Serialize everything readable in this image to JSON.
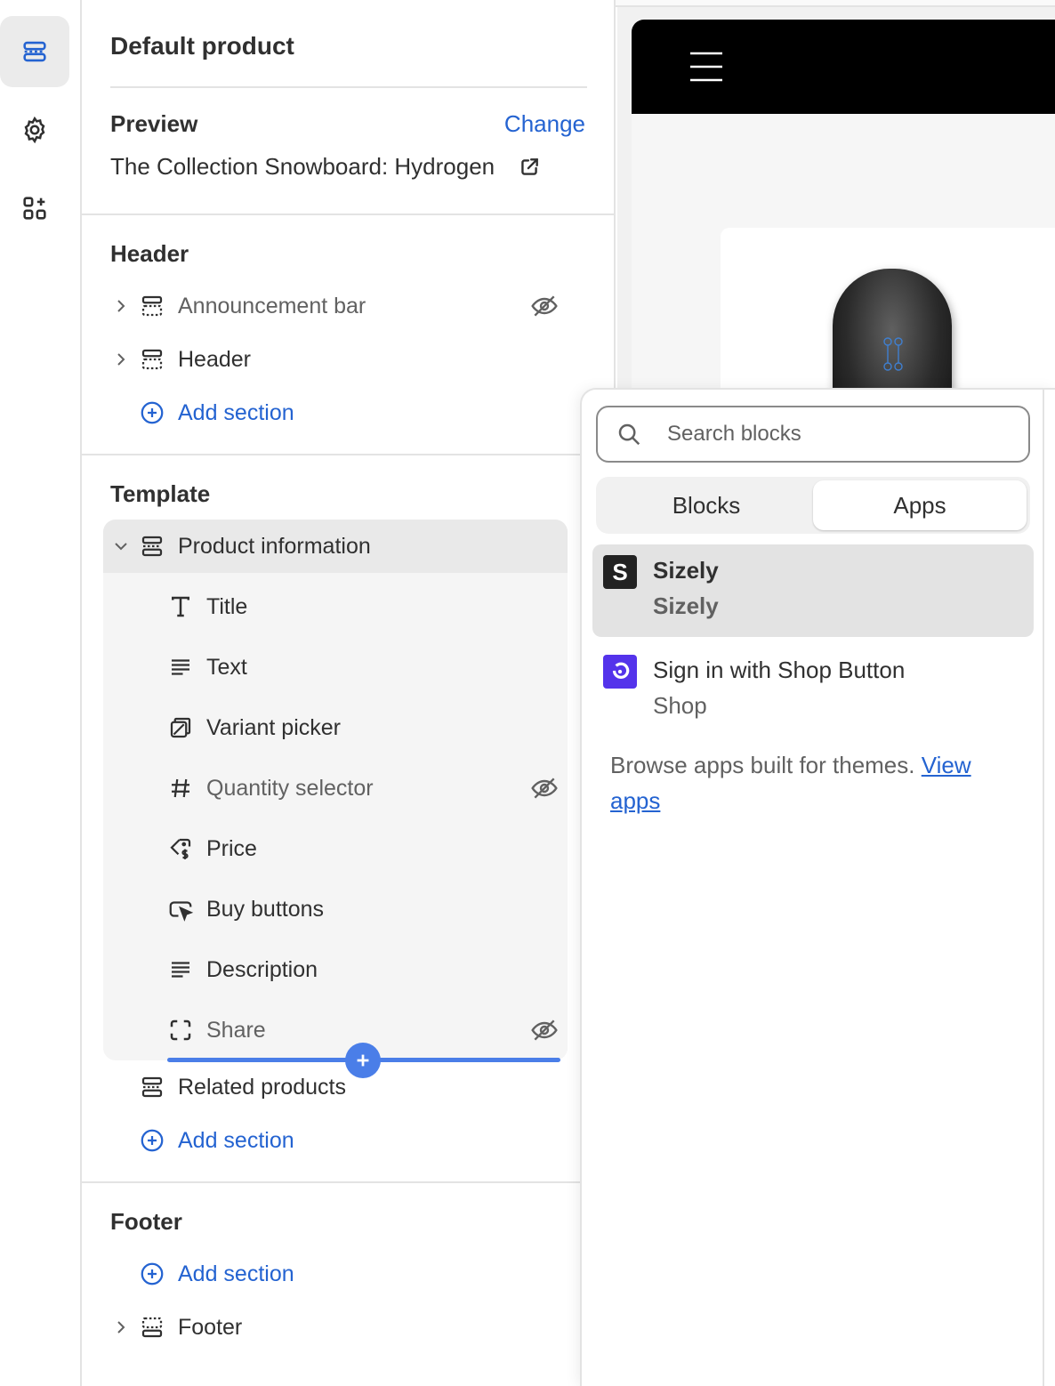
{
  "editor": {
    "page_title": "Default product",
    "preview_label": "Preview",
    "change_label": "Change",
    "preview_value": "The Collection Snowboard: Hydrogen"
  },
  "groups": {
    "header_title": "Header",
    "template_title": "Template",
    "footer_title": "Footer",
    "add_section": "Add section"
  },
  "header_sections": [
    {
      "label": "Announcement bar",
      "hidden": true
    },
    {
      "label": "Header",
      "hidden": false
    }
  ],
  "template": {
    "product_information": "Product information",
    "blocks": [
      {
        "label": "Title",
        "icon": "title-icon",
        "hidden": false
      },
      {
        "label": "Text",
        "icon": "text-icon",
        "hidden": false
      },
      {
        "label": "Variant picker",
        "icon": "variant-picker-icon",
        "hidden": false
      },
      {
        "label": "Quantity selector",
        "icon": "hash-icon",
        "hidden": true
      },
      {
        "label": "Price",
        "icon": "price-tag-icon",
        "hidden": false
      },
      {
        "label": "Buy buttons",
        "icon": "cursor-button-icon",
        "hidden": false
      },
      {
        "label": "Description",
        "icon": "text-icon",
        "hidden": false
      },
      {
        "label": "Share",
        "icon": "share-frame-icon",
        "hidden": true
      }
    ],
    "related_products": "Related products"
  },
  "footer_sections": [
    {
      "label": "Footer"
    }
  ],
  "popover": {
    "search_placeholder": "Search blocks",
    "tabs": [
      "Blocks",
      "Apps"
    ],
    "selected_tab": "Apps",
    "apps": [
      {
        "name": "Sizely",
        "provider": "Sizely",
        "logo_letter": "S",
        "logo_color": "#222222"
      },
      {
        "name": "Sign in with Shop Button",
        "provider": "Shop",
        "logo_color": "#5433eb"
      }
    ],
    "browse_text": "Browse apps built for themes.",
    "browse_link": "View apps"
  },
  "colors": {
    "link": "#2463d1",
    "insert_accent": "#4a7ee8",
    "active_rail": "#ebebeb"
  }
}
